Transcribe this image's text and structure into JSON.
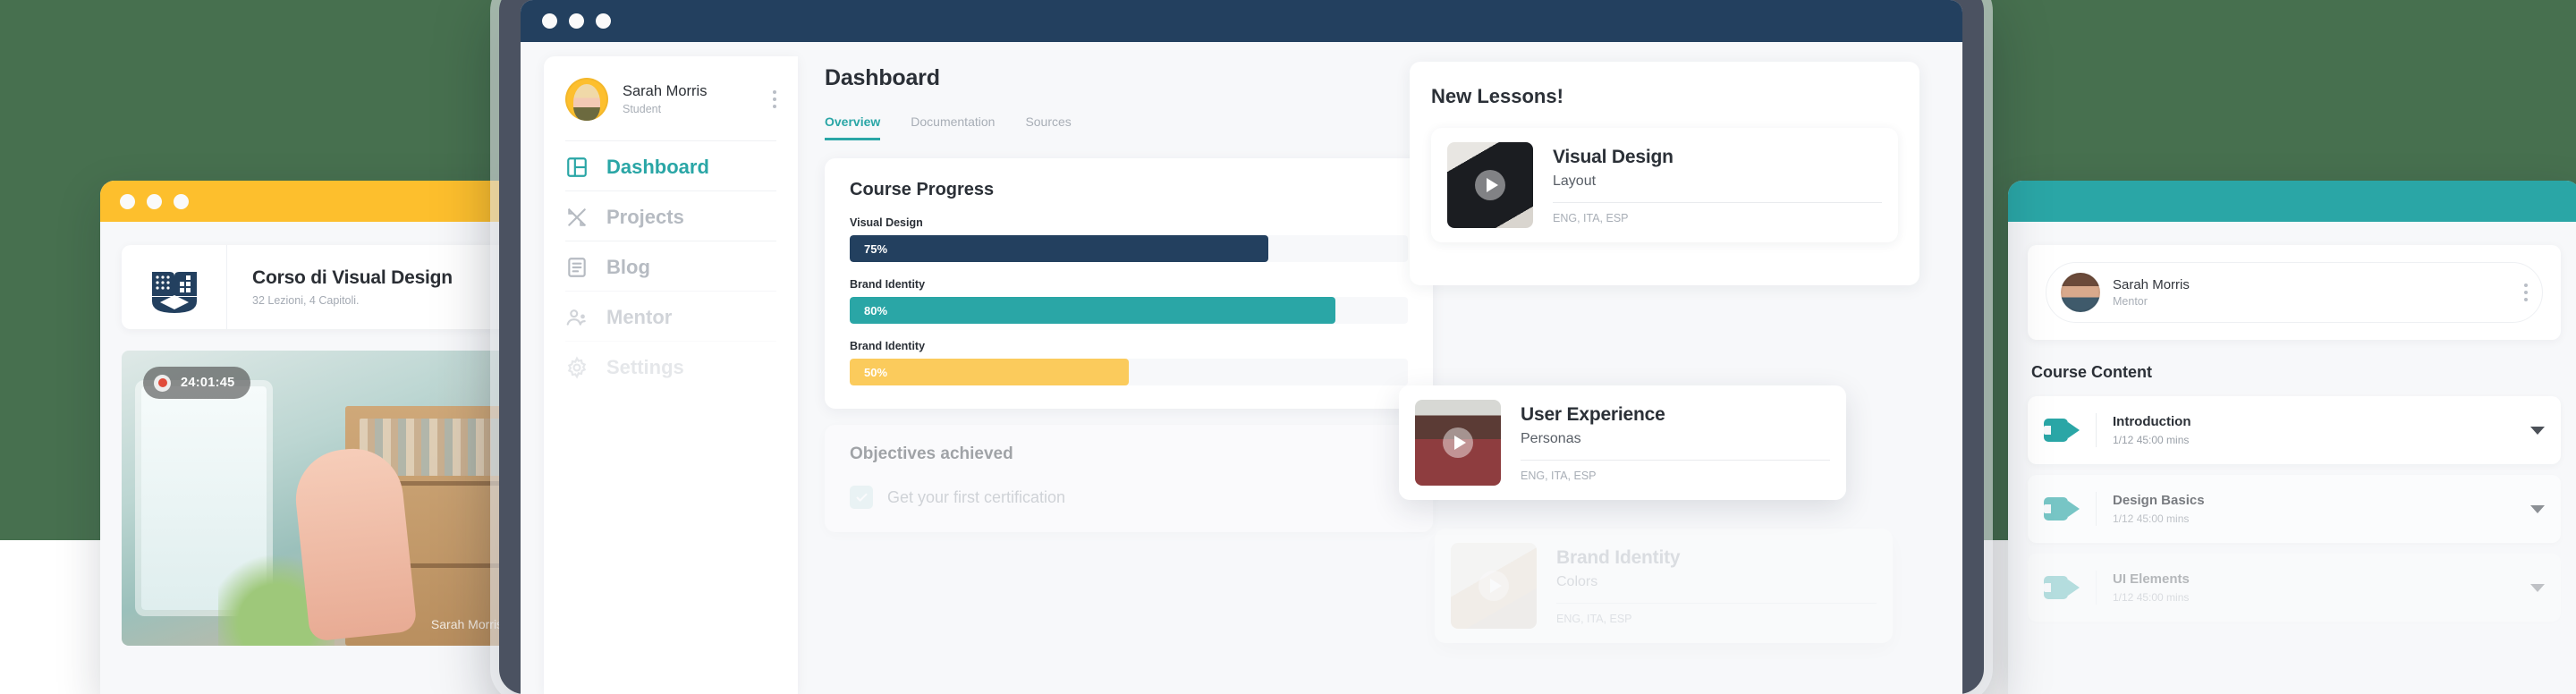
{
  "theme": {
    "background_green": "#47704F",
    "navy": "#23405F",
    "teal": "#2AA6A6",
    "yellow": "#FDBF2D",
    "bar_navy": "#23405F",
    "bar_teal": "#2AA6A6",
    "bar_yellow": "#FBCB5C"
  },
  "left_window": {
    "titlebar_color": "#FDBF2D",
    "course": {
      "logo_icon": "open-book-graduation-cap-icon",
      "title": "Corso di Visual Design",
      "subtitle": "32 Lezioni, 4 Capitoli."
    },
    "video": {
      "timestamp": "24:01:45",
      "record_icon": "record-dot-icon",
      "presenter": "Sarah Morris"
    }
  },
  "main_window": {
    "titlebar_color": "#23405F",
    "sidebar": {
      "user": {
        "name": "Sarah Morris",
        "role": "Student",
        "menu_icon": "kebab-menu-icon",
        "avatar": "avatar"
      },
      "items": [
        {
          "label": "Dashboard",
          "icon": "layout-dashboard-icon",
          "active": true
        },
        {
          "label": "Projects",
          "icon": "pen-ruler-icon",
          "active": false
        },
        {
          "label": "Blog",
          "icon": "document-lines-icon",
          "active": false
        },
        {
          "label": "Mentor",
          "icon": "people-icon",
          "active": false
        },
        {
          "label": "Settings",
          "icon": "gear-icon",
          "active": false
        }
      ]
    },
    "header": {
      "title": "Dashboard"
    },
    "tabs": [
      {
        "label": "Overview",
        "active": true
      },
      {
        "label": "Documentation",
        "active": false
      },
      {
        "label": "Sources",
        "active": false
      }
    ],
    "course_progress": {
      "title": "Course Progress",
      "bars": [
        {
          "label": "Visual Design",
          "value": "75%",
          "percent": 75,
          "color": "#23405F"
        },
        {
          "label": "Brand Identity",
          "value": "80%",
          "percent": 80,
          "color": "#2AA6A6"
        },
        {
          "label": "Brand Identity",
          "value": "50%",
          "percent": 50,
          "color": "#FBCB5C"
        }
      ]
    },
    "objectives": {
      "title": "Objectives achieved",
      "items": [
        {
          "label": "Get your first certification",
          "checked": true,
          "icon": "check-icon"
        }
      ]
    },
    "new_lessons": {
      "title": "New Lessons!",
      "cards": [
        {
          "title": "Visual Design",
          "subtitle": "Layout",
          "langs": "ENG, ITA, ESP",
          "thumb_icon": "video-thumbnail",
          "play_icon": "play-icon"
        },
        {
          "title": "User Experience",
          "subtitle": "Personas",
          "langs": "ENG, ITA, ESP",
          "thumb_icon": "video-thumbnail",
          "play_icon": "play-icon"
        },
        {
          "title": "Brand Identity",
          "subtitle": "Colors",
          "langs": "ENG, ITA, ESP",
          "thumb_icon": "video-thumbnail",
          "play_icon": "play-icon"
        }
      ]
    }
  },
  "right_window": {
    "titlebar_color": "#2AA6A6",
    "mentor": {
      "name": "Sarah Morris",
      "role": "Mentor",
      "menu_icon": "kebab-menu-icon",
      "avatar": "avatar"
    },
    "course_content": {
      "title": "Course Content",
      "rows": [
        {
          "name": "Introduction",
          "meta": "1/12 45:00 mins",
          "icon": "video-camera-icon",
          "caret": "chevron-down-icon"
        },
        {
          "name": "Design Basics",
          "meta": "1/12 45:00 mins",
          "icon": "video-camera-icon",
          "caret": "chevron-down-icon"
        },
        {
          "name": "UI Elements",
          "meta": "1/12 45:00 mins",
          "icon": "video-camera-icon",
          "caret": "chevron-down-icon"
        }
      ]
    }
  }
}
